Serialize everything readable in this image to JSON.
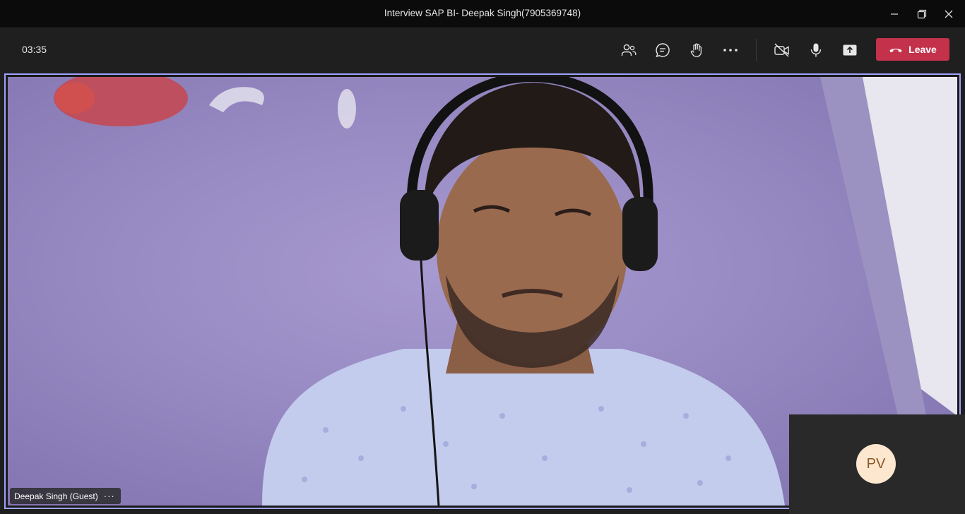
{
  "window": {
    "title": "Interview SAP BI- Deepak Singh(7905369748)"
  },
  "toolbar": {
    "timer": "03:35",
    "buttons": [
      {
        "icon": "people-icon"
      },
      {
        "icon": "chat-icon"
      },
      {
        "icon": "raise-hand-icon"
      },
      {
        "icon": "more-icon"
      },
      {
        "icon": "camera-off-icon"
      },
      {
        "icon": "microphone-icon"
      },
      {
        "icon": "share-screen-icon"
      }
    ],
    "leave_label": "Leave",
    "leave_color": "#c4314b"
  },
  "stage": {
    "active_border_color": "#9ea2ff",
    "participant_name": "Deepak Singh (Guest)",
    "more_glyph": "···"
  },
  "self_view": {
    "initials": "PV",
    "avatar_bg": "#fde7cf"
  }
}
